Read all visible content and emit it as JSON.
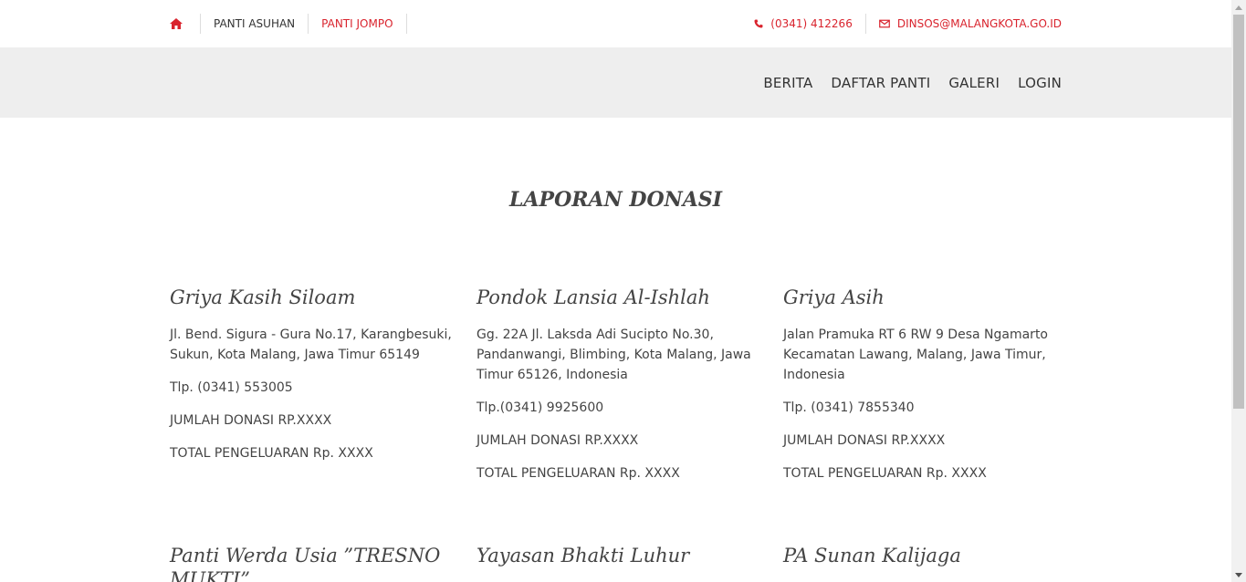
{
  "topbar": {
    "links": [
      "PANTI ASUHAN",
      "PANTI JOMPO"
    ],
    "phone": "(0341) 412266",
    "email": "DINSOS@MALANGKOTA.GO.ID"
  },
  "nav": {
    "items": [
      "BERITA",
      "DAFTAR PANTI",
      "GALERI",
      "LOGIN"
    ]
  },
  "page_title": "LAPORAN DONASI",
  "cards": [
    {
      "name": "Griya Kasih Siloam",
      "address": "Jl. Bend. Sigura - Gura No.17, Karangbesuki, Sukun, Kota Malang, Jawa Timur 65149",
      "phone": "Tlp. (0341) 553005",
      "donation": "JUMLAH DONASI RP.XXXX",
      "expense": "TOTAL PENGELUARAN Rp. XXXX"
    },
    {
      "name": "Pondok Lansia Al-Ishlah",
      "address": "Gg. 22A Jl. Laksda Adi Sucipto No.30, Pandanwangi, Blimbing, Kota Malang, Jawa Timur 65126, Indonesia",
      "phone": "Tlp.(0341) 9925600",
      "donation": "JUMLAH DONASI RP.XXXX",
      "expense": "TOTAL PENGELUARAN Rp. XXXX"
    },
    {
      "name": "Griya Asih",
      "address": "Jalan Pramuka RT 6 RW 9 Desa Ngamarto Kecamatan Lawang, Malang, Jawa Timur, Indonesia",
      "phone": "Tlp. (0341) 7855340",
      "donation": "JUMLAH DONASI RP.XXXX",
      "expense": "TOTAL PENGELUARAN Rp. XXXX"
    },
    {
      "name": "Panti Werda Usia ”TRESNO MUKTI”"
    },
    {
      "name": "Yayasan Bhakti Luhur"
    },
    {
      "name": "PA Sunan Kalijaga"
    }
  ],
  "icons": {
    "home": "home-icon",
    "phone": "phone-icon",
    "email": "envelope-icon"
  },
  "colors": {
    "accent": "#d9232d",
    "navbar_bg": "#eeeeee",
    "text": "#444444"
  }
}
